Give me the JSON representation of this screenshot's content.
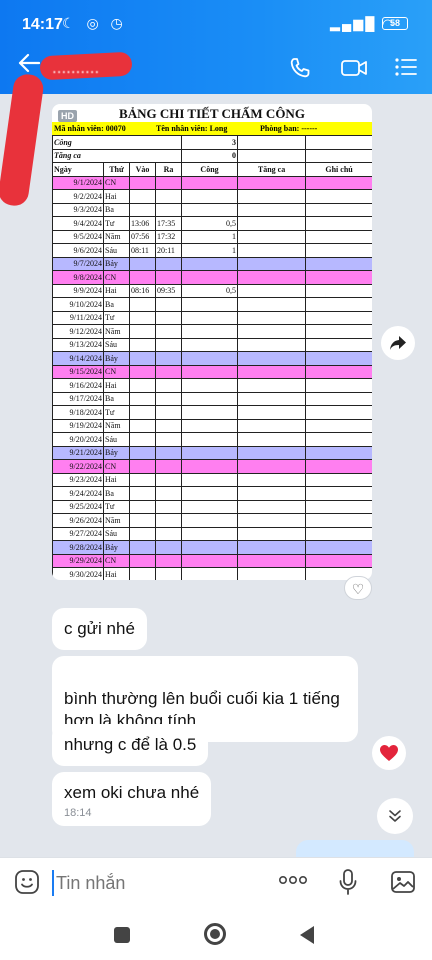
{
  "status_bar": {
    "time": "14:17",
    "status_icons": "☾ ◎ ◷",
    "signal": "▂▄▆█ ◠",
    "battery": "58"
  },
  "header": {
    "back_icon": "arrow-left-icon",
    "contact_name": "..........",
    "call_icon": "phone-icon",
    "video_icon": "video-icon",
    "menu_icon": "menu-icon"
  },
  "image_message": {
    "hd_badge": "HD",
    "sheet": {
      "title": "BẢNG CHI TIẾT CHẤM CÔNG",
      "employee_id": "Mã nhân viên: 00070",
      "employee_name": "Tên nhân viên: Long",
      "department": "Phòng ban: ------",
      "cong_label": "Công",
      "cong_value": "3",
      "tang_ca_label": "Tăng ca",
      "tang_ca_value": "0",
      "columns": [
        "Ngày",
        "Thứ",
        "Vào",
        "Ra",
        "Công",
        "Tăng ca",
        "Ghi chú"
      ],
      "rows": [
        {
          "date": "9/1/2024",
          "day": "CN",
          "in": "",
          "out": "",
          "cong": "",
          "style": "pink"
        },
        {
          "date": "9/2/2024",
          "day": "Hai",
          "in": "",
          "out": "",
          "cong": "",
          "style": ""
        },
        {
          "date": "9/3/2024",
          "day": "Ba",
          "in": "",
          "out": "",
          "cong": "",
          "style": ""
        },
        {
          "date": "9/4/2024",
          "day": "Tư",
          "in": "13:06",
          "out": "17:35",
          "cong": "0,5",
          "style": ""
        },
        {
          "date": "9/5/2024",
          "day": "Năm",
          "in": "07:56",
          "out": "17:32",
          "cong": "1",
          "style": ""
        },
        {
          "date": "9/6/2024",
          "day": "Sáu",
          "in": "08:11",
          "out": "20:11",
          "cong": "1",
          "style": ""
        },
        {
          "date": "9/7/2024",
          "day": "Bảy",
          "in": "",
          "out": "",
          "cong": "",
          "style": "lav"
        },
        {
          "date": "9/8/2024",
          "day": "CN",
          "in": "",
          "out": "",
          "cong": "",
          "style": "pink"
        },
        {
          "date": "9/9/2024",
          "day": "Hai",
          "in": "08:16",
          "out": "09:35",
          "cong": "0,5",
          "style": ""
        },
        {
          "date": "9/10/2024",
          "day": "Ba",
          "in": "",
          "out": "",
          "cong": "",
          "style": ""
        },
        {
          "date": "9/11/2024",
          "day": "Tư",
          "in": "",
          "out": "",
          "cong": "",
          "style": ""
        },
        {
          "date": "9/12/2024",
          "day": "Năm",
          "in": "",
          "out": "",
          "cong": "",
          "style": ""
        },
        {
          "date": "9/13/2024",
          "day": "Sáu",
          "in": "",
          "out": "",
          "cong": "",
          "style": ""
        },
        {
          "date": "9/14/2024",
          "day": "Bảy",
          "in": "",
          "out": "",
          "cong": "",
          "style": "lav"
        },
        {
          "date": "9/15/2024",
          "day": "CN",
          "in": "",
          "out": "",
          "cong": "",
          "style": "pink"
        },
        {
          "date": "9/16/2024",
          "day": "Hai",
          "in": "",
          "out": "",
          "cong": "",
          "style": ""
        },
        {
          "date": "9/17/2024",
          "day": "Ba",
          "in": "",
          "out": "",
          "cong": "",
          "style": ""
        },
        {
          "date": "9/18/2024",
          "day": "Tư",
          "in": "",
          "out": "",
          "cong": "",
          "style": ""
        },
        {
          "date": "9/19/2024",
          "day": "Năm",
          "in": "",
          "out": "",
          "cong": "",
          "style": ""
        },
        {
          "date": "9/20/2024",
          "day": "Sáu",
          "in": "",
          "out": "",
          "cong": "",
          "style": ""
        },
        {
          "date": "9/21/2024",
          "day": "Bảy",
          "in": "",
          "out": "",
          "cong": "",
          "style": "lav"
        },
        {
          "date": "9/22/2024",
          "day": "CN",
          "in": "",
          "out": "",
          "cong": "",
          "style": "pink"
        },
        {
          "date": "9/23/2024",
          "day": "Hai",
          "in": "",
          "out": "",
          "cong": "",
          "style": ""
        },
        {
          "date": "9/24/2024",
          "day": "Ba",
          "in": "",
          "out": "",
          "cong": "",
          "style": ""
        },
        {
          "date": "9/25/2024",
          "day": "Tư",
          "in": "",
          "out": "",
          "cong": "",
          "style": ""
        },
        {
          "date": "9/26/2024",
          "day": "Năm",
          "in": "",
          "out": "",
          "cong": "",
          "style": ""
        },
        {
          "date": "9/27/2024",
          "day": "Sáu",
          "in": "",
          "out": "",
          "cong": "",
          "style": ""
        },
        {
          "date": "9/28/2024",
          "day": "Bảy",
          "in": "",
          "out": "",
          "cong": "",
          "style": "lav"
        },
        {
          "date": "9/29/2024",
          "day": "CN",
          "in": "",
          "out": "",
          "cong": "",
          "style": "pink"
        },
        {
          "date": "9/30/2024",
          "day": "Hai",
          "in": "",
          "out": "",
          "cong": "",
          "style": ""
        }
      ]
    },
    "reaction_icon": "heart-outline-icon",
    "share_icon": "share-icon"
  },
  "messages": [
    {
      "text": "c gửi nhé"
    },
    {
      "text": "bình thường lên buổi cuối kia 1 tiếng\nhơn là không tính"
    },
    {
      "text": "nhưng c để là 0.5"
    },
    {
      "text": "xem oki chưa nhé",
      "time": "18:14"
    }
  ],
  "reaction": {
    "icon": "heart-icon"
  },
  "scroll_down_icon": "double-chevron-down-icon",
  "input_bar": {
    "emoji_icon": "sticker-icon",
    "placeholder": "Tin nhắn",
    "more_icon": "more-icon",
    "mic_icon": "mic-icon",
    "gallery_icon": "image-icon"
  },
  "nav_bar": {
    "recents": "recents-button",
    "home": "home-button",
    "back": "back-button"
  },
  "colors": {
    "header_blue": "#1a8ef6",
    "pink_row": "#ff7ff0",
    "lavender_row": "#b7b8ff",
    "yellow_bar": "#ffff00",
    "heart_red": "#e3243b"
  }
}
